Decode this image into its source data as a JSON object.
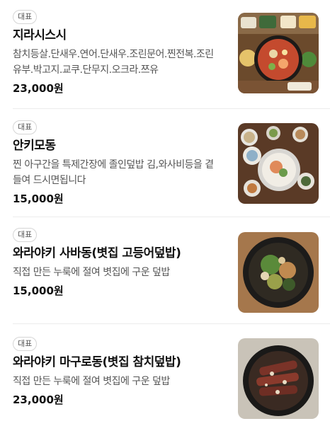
{
  "menu": [
    {
      "badge": "대표",
      "name": "지라시스시",
      "description": "참치등살.단새우.연어.단새우.조린문어.찐전복.조린유부.박고지.교쿠.단무지.오크라.쯔유",
      "price": "23,000원",
      "image_icon": "chirashi-sushi-photo"
    },
    {
      "badge": "대표",
      "name": "안키모동",
      "description": "찐 아구간을 특제간장에 졸인덮밥 김,와사비등을 곁들여 드시면됩니다",
      "price": "15,000원",
      "image_icon": "ankimo-don-photo"
    },
    {
      "badge": "대표",
      "name": "와라야키 사바동(볏집 고등어덮밥)",
      "description": "직접 만든 누룩에 절여 볏집에 구운 덮밥",
      "price": "15,000원",
      "image_icon": "saba-don-photo"
    },
    {
      "badge": "대표",
      "name": "와라야키 마구로동(볏집 참치덮밥)",
      "description": "직접 만든 누룩에 절여 볏집에 구운 덮밥",
      "price": "23,000원",
      "image_icon": "maguro-don-photo"
    }
  ]
}
